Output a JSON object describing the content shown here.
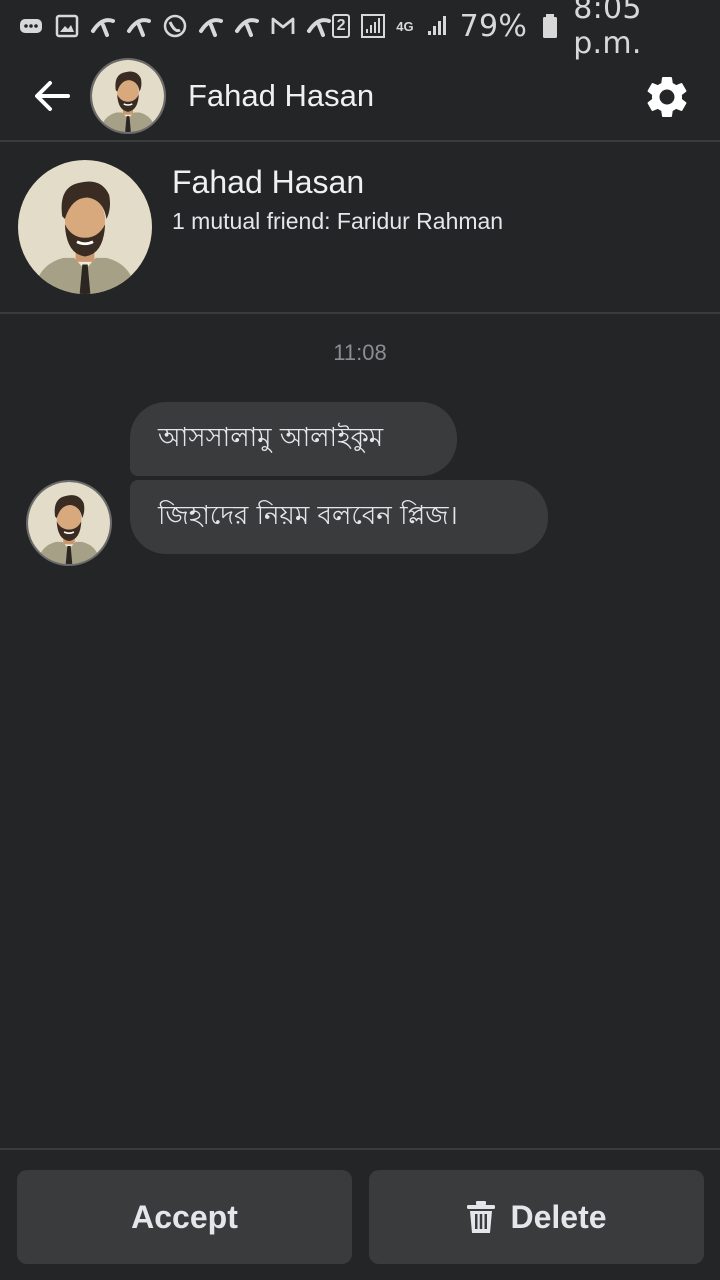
{
  "status_bar": {
    "battery_percent": "79%",
    "time": "8:05 p.m.",
    "sim_slot": "2",
    "network": "4G",
    "icons_left": [
      "messages-icon",
      "gallery-icon",
      "telco-icon",
      "telco-icon",
      "phone-circle-icon",
      "telco-icon",
      "telco-icon",
      "gmail-icon",
      "telco-icon"
    ],
    "icons_right": [
      "sim2-icon",
      "signal-icon",
      "4g-icon",
      "signal-icon",
      "battery-icon"
    ]
  },
  "header": {
    "name": "Fahad Hasan",
    "back_icon": "back-arrow-icon",
    "settings_icon": "gear-icon"
  },
  "profile": {
    "name": "Fahad Hasan",
    "mutual": "1 mutual friend: Faridur Rahman"
  },
  "conversation": {
    "timestamp": "11:08",
    "messages": [
      {
        "text": "আসসালামু আলাইকুম"
      },
      {
        "text": "জিহাদের নিয়ম বলবেন প্লিজ।"
      }
    ]
  },
  "actions": {
    "accept_label": "Accept",
    "delete_label": "Delete",
    "delete_icon": "trash-icon"
  },
  "colors": {
    "background": "#242526",
    "bubble": "#3a3b3c",
    "text": "#e4e6eb",
    "muted": "#8a8d91"
  }
}
